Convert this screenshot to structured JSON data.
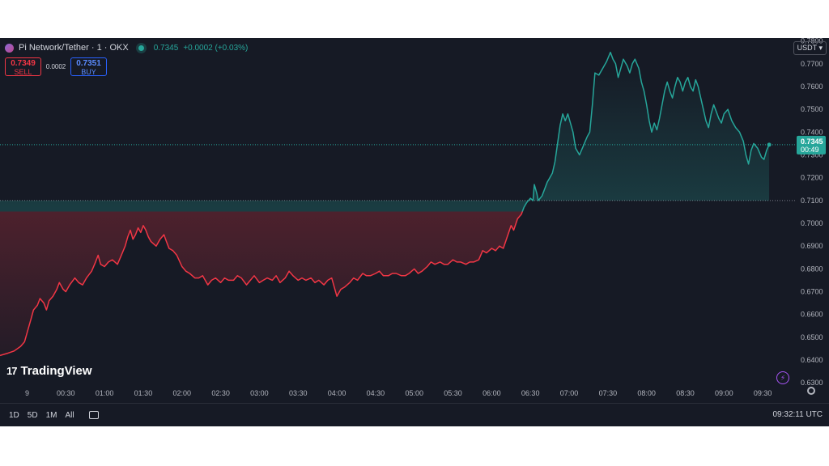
{
  "header": {
    "symbol": "Pi Network/Tether · 1 · OKX",
    "last_price": "0.7345",
    "change": "+0.0002 (+0.03%)"
  },
  "trade": {
    "sell_price": "0.7349",
    "sell_label": "SELL",
    "spread": "0.0002",
    "buy_price": "0.7351",
    "buy_label": "BUY"
  },
  "currency_button": "USDT",
  "brand": "TradingView",
  "price_badge": {
    "price": "0.7345",
    "countdown": "00:49"
  },
  "ranges": [
    "1D",
    "5D",
    "1M",
    "All"
  ],
  "clock": "09:32:11 UTC",
  "colors": {
    "background": "#161a25",
    "down": "#f23645",
    "up": "#26a69a"
  },
  "chart_data": {
    "type": "area",
    "baseline": 0.71,
    "y_ticks": [
      "0.7800",
      "0.7700",
      "0.7600",
      "0.7500",
      "0.7400",
      "0.7300",
      "0.7200",
      "0.7100",
      "0.7000",
      "0.6900",
      "0.6800",
      "0.6700",
      "0.6600",
      "0.6500",
      "0.6400",
      "0.6300"
    ],
    "ylim": [
      0.6283,
      0.7813
    ],
    "x_ticks": [
      "9",
      "00:30",
      "01:00",
      "01:30",
      "02:00",
      "02:30",
      "03:00",
      "03:30",
      "04:00",
      "04:30",
      "05:00",
      "05:30",
      "06:00",
      "06:30",
      "07:00",
      "07:30",
      "08:00",
      "08:30",
      "09:00",
      "09:30"
    ],
    "x_tick_minutes": [
      0,
      30,
      60,
      90,
      120,
      150,
      180,
      210,
      240,
      270,
      300,
      330,
      360,
      390,
      420,
      450,
      480,
      510,
      540,
      570
    ],
    "xlim": [
      -21,
      595
    ],
    "last_value": 0.7345,
    "points": [
      [
        -21,
        0.642
      ],
      [
        -15,
        0.643
      ],
      [
        -10,
        0.644
      ],
      [
        -5,
        0.646
      ],
      [
        -2,
        0.648
      ],
      [
        0,
        0.652
      ],
      [
        3,
        0.658
      ],
      [
        5,
        0.662
      ],
      [
        8,
        0.664
      ],
      [
        10,
        0.667
      ],
      [
        13,
        0.665
      ],
      [
        15,
        0.662
      ],
      [
        17,
        0.666
      ],
      [
        20,
        0.668
      ],
      [
        23,
        0.671
      ],
      [
        25,
        0.674
      ],
      [
        28,
        0.671
      ],
      [
        30,
        0.67
      ],
      [
        33,
        0.673
      ],
      [
        37,
        0.676
      ],
      [
        40,
        0.674
      ],
      [
        43,
        0.673
      ],
      [
        46,
        0.676
      ],
      [
        50,
        0.679
      ],
      [
        53,
        0.683
      ],
      [
        55,
        0.686
      ],
      [
        57,
        0.682
      ],
      [
        60,
        0.681
      ],
      [
        63,
        0.683
      ],
      [
        66,
        0.684
      ],
      [
        70,
        0.682
      ],
      [
        73,
        0.686
      ],
      [
        76,
        0.69
      ],
      [
        78,
        0.694
      ],
      [
        80,
        0.697
      ],
      [
        82,
        0.693
      ],
      [
        84,
        0.695
      ],
      [
        86,
        0.698
      ],
      [
        88,
        0.696
      ],
      [
        90,
        0.699
      ],
      [
        92,
        0.697
      ],
      [
        94,
        0.694
      ],
      [
        96,
        0.692
      ],
      [
        98,
        0.691
      ],
      [
        100,
        0.69
      ],
      [
        103,
        0.693
      ],
      [
        106,
        0.695
      ],
      [
        108,
        0.692
      ],
      [
        110,
        0.689
      ],
      [
        113,
        0.688
      ],
      [
        116,
        0.686
      ],
      [
        120,
        0.681
      ],
      [
        123,
        0.679
      ],
      [
        126,
        0.678
      ],
      [
        130,
        0.676
      ],
      [
        133,
        0.676
      ],
      [
        136,
        0.677
      ],
      [
        140,
        0.673
      ],
      [
        143,
        0.675
      ],
      [
        146,
        0.676
      ],
      [
        150,
        0.674
      ],
      [
        153,
        0.676
      ],
      [
        156,
        0.675
      ],
      [
        160,
        0.675
      ],
      [
        163,
        0.677
      ],
      [
        166,
        0.676
      ],
      [
        170,
        0.673
      ],
      [
        173,
        0.675
      ],
      [
        176,
        0.677
      ],
      [
        180,
        0.674
      ],
      [
        183,
        0.675
      ],
      [
        186,
        0.676
      ],
      [
        190,
        0.675
      ],
      [
        193,
        0.677
      ],
      [
        196,
        0.674
      ],
      [
        200,
        0.676
      ],
      [
        203,
        0.679
      ],
      [
        206,
        0.677
      ],
      [
        210,
        0.675
      ],
      [
        213,
        0.676
      ],
      [
        216,
        0.675
      ],
      [
        220,
        0.676
      ],
      [
        223,
        0.674
      ],
      [
        226,
        0.675
      ],
      [
        230,
        0.673
      ],
      [
        233,
        0.675
      ],
      [
        236,
        0.676
      ],
      [
        240,
        0.668
      ],
      [
        243,
        0.671
      ],
      [
        246,
        0.672
      ],
      [
        250,
        0.674
      ],
      [
        253,
        0.676
      ],
      [
        256,
        0.675
      ],
      [
        260,
        0.678
      ],
      [
        263,
        0.677
      ],
      [
        266,
        0.677
      ],
      [
        270,
        0.678
      ],
      [
        273,
        0.679
      ],
      [
        276,
        0.677
      ],
      [
        280,
        0.677
      ],
      [
        283,
        0.678
      ],
      [
        286,
        0.678
      ],
      [
        290,
        0.677
      ],
      [
        293,
        0.677
      ],
      [
        296,
        0.678
      ],
      [
        300,
        0.68
      ],
      [
        303,
        0.678
      ],
      [
        306,
        0.679
      ],
      [
        310,
        0.681
      ],
      [
        313,
        0.683
      ],
      [
        316,
        0.682
      ],
      [
        320,
        0.683
      ],
      [
        323,
        0.682
      ],
      [
        326,
        0.682
      ],
      [
        330,
        0.684
      ],
      [
        333,
        0.683
      ],
      [
        336,
        0.683
      ],
      [
        340,
        0.682
      ],
      [
        343,
        0.683
      ],
      [
        346,
        0.683
      ],
      [
        350,
        0.684
      ],
      [
        353,
        0.688
      ],
      [
        356,
        0.687
      ],
      [
        360,
        0.689
      ],
      [
        363,
        0.688
      ],
      [
        366,
        0.69
      ],
      [
        369,
        0.689
      ],
      [
        372,
        0.694
      ],
      [
        375,
        0.699
      ],
      [
        377,
        0.697
      ],
      [
        380,
        0.702
      ],
      [
        383,
        0.704
      ],
      [
        385,
        0.707
      ],
      [
        387,
        0.709
      ],
      [
        390,
        0.711
      ],
      [
        392,
        0.71
      ],
      [
        393,
        0.717
      ],
      [
        395,
        0.713
      ],
      [
        396,
        0.71
      ],
      [
        399,
        0.712
      ],
      [
        401,
        0.715
      ],
      [
        403,
        0.718
      ],
      [
        405,
        0.72
      ],
      [
        407,
        0.722
      ],
      [
        409,
        0.727
      ],
      [
        411,
        0.735
      ],
      [
        413,
        0.743
      ],
      [
        415,
        0.748
      ],
      [
        417,
        0.745
      ],
      [
        419,
        0.748
      ],
      [
        421,
        0.744
      ],
      [
        423,
        0.74
      ],
      [
        425,
        0.733
      ],
      [
        428,
        0.73
      ],
      [
        431,
        0.734
      ],
      [
        434,
        0.738
      ],
      [
        436,
        0.74
      ],
      [
        438,
        0.752
      ],
      [
        440,
        0.766
      ],
      [
        443,
        0.765
      ],
      [
        446,
        0.768
      ],
      [
        449,
        0.771
      ],
      [
        452,
        0.775
      ],
      [
        454,
        0.772
      ],
      [
        456,
        0.77
      ],
      [
        458,
        0.764
      ],
      [
        460,
        0.768
      ],
      [
        462,
        0.772
      ],
      [
        465,
        0.769
      ],
      [
        467,
        0.766
      ],
      [
        469,
        0.77
      ],
      [
        471,
        0.772
      ],
      [
        474,
        0.768
      ],
      [
        476,
        0.762
      ],
      [
        478,
        0.758
      ],
      [
        480,
        0.752
      ],
      [
        482,
        0.745
      ],
      [
        484,
        0.74
      ],
      [
        486,
        0.744
      ],
      [
        488,
        0.741
      ],
      [
        490,
        0.746
      ],
      [
        492,
        0.752
      ],
      [
        494,
        0.758
      ],
      [
        496,
        0.762
      ],
      [
        498,
        0.758
      ],
      [
        500,
        0.755
      ],
      [
        502,
        0.76
      ],
      [
        504,
        0.764
      ],
      [
        506,
        0.762
      ],
      [
        508,
        0.758
      ],
      [
        510,
        0.762
      ],
      [
        512,
        0.764
      ],
      [
        514,
        0.76
      ],
      [
        516,
        0.758
      ],
      [
        518,
        0.763
      ],
      [
        520,
        0.76
      ],
      [
        522,
        0.755
      ],
      [
        524,
        0.75
      ],
      [
        526,
        0.745
      ],
      [
        528,
        0.742
      ],
      [
        530,
        0.748
      ],
      [
        532,
        0.752
      ],
      [
        534,
        0.749
      ],
      [
        536,
        0.746
      ],
      [
        538,
        0.744
      ],
      [
        540,
        0.748
      ],
      [
        543,
        0.75
      ],
      [
        546,
        0.745
      ],
      [
        549,
        0.742
      ],
      [
        552,
        0.74
      ],
      [
        555,
        0.736
      ],
      [
        557,
        0.73
      ],
      [
        559,
        0.726
      ],
      [
        561,
        0.732
      ],
      [
        563,
        0.735
      ],
      [
        566,
        0.733
      ],
      [
        569,
        0.729
      ],
      [
        571,
        0.728
      ],
      [
        573,
        0.732
      ],
      [
        575,
        0.7345
      ]
    ]
  }
}
